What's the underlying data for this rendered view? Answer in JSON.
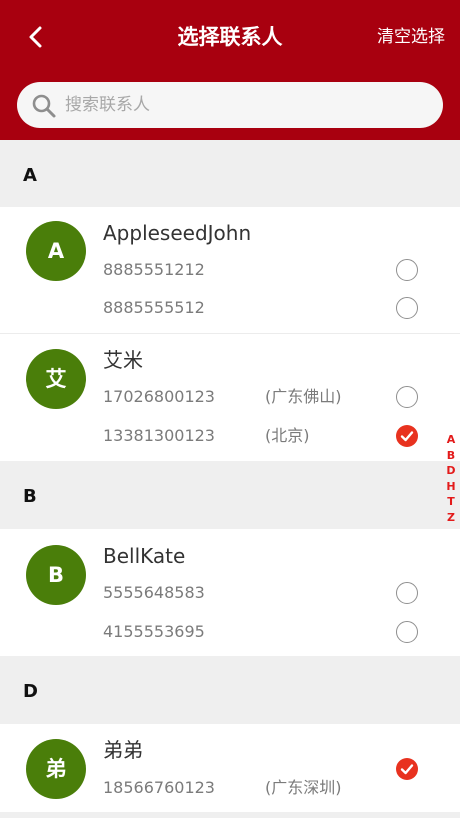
{
  "header": {
    "title": "选择联系人",
    "clear_label": "清空选择"
  },
  "search": {
    "placeholder": "搜索联系人"
  },
  "index_letters": [
    "A",
    "B",
    "D",
    "H",
    "T",
    "Z"
  ],
  "sections": [
    {
      "letter": "A",
      "contacts": [
        {
          "avatar": "A",
          "name": "AppleseedJohn",
          "phones": [
            {
              "number": "8885551212",
              "location": "",
              "selected": false
            },
            {
              "number": "8885555512",
              "location": "",
              "selected": false
            }
          ]
        },
        {
          "avatar": "艾",
          "name": "艾米",
          "phones": [
            {
              "number": "17026800123",
              "location": "(广东佛山)",
              "selected": false
            },
            {
              "number": "13381300123",
              "location": "(北京)",
              "selected": true
            }
          ]
        }
      ]
    },
    {
      "letter": "B",
      "contacts": [
        {
          "avatar": "B",
          "name": "BellKate",
          "phones": [
            {
              "number": "5555648583",
              "location": "",
              "selected": false
            },
            {
              "number": "4155553695",
              "location": "",
              "selected": false
            }
          ]
        }
      ]
    },
    {
      "letter": "D",
      "contacts": [
        {
          "avatar": "弟",
          "name": "弟弟",
          "phones": [
            {
              "number": "18566760123",
              "location": "(广东深圳)",
              "selected": true
            }
          ]
        }
      ]
    }
  ],
  "colors": {
    "header_bg": "#a8000f",
    "avatar_bg": "#4a7e0a",
    "check_on": "#e8321f",
    "index_text": "#e31b1b"
  }
}
